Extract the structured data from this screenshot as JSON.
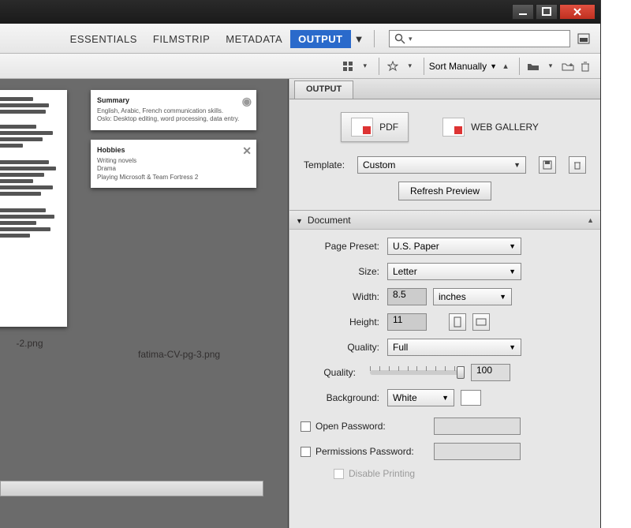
{
  "workspaces": {
    "essentials": "ESSENTIALS",
    "filmstrip": "FILMSTRIP",
    "metadata": "METADATA",
    "output": "OUTPUT"
  },
  "search": {
    "placeholder": ""
  },
  "sortbar": {
    "sort_label": "Sort Manually"
  },
  "thumbs": {
    "file1": "-2.png",
    "file2": "fatima-CV-pg-3.png"
  },
  "panel": {
    "tab": "OUTPUT",
    "mode_pdf": "PDF",
    "mode_web": "WEB GALLERY",
    "template_label": "Template:",
    "template_value": "Custom",
    "refresh": "Refresh Preview",
    "doc_header": "Document",
    "page_preset_label": "Page Preset:",
    "page_preset_value": "U.S. Paper",
    "size_label": "Size:",
    "size_value": "Letter",
    "width_label": "Width:",
    "width_value": "8.5",
    "width_units": "inches",
    "height_label": "Height:",
    "height_value": "11",
    "quality_label": "Quality:",
    "quality_value": "Full",
    "quality_slider_label": "Quality:",
    "quality_num": "100",
    "background_label": "Background:",
    "background_value": "White",
    "open_pw_label": "Open Password:",
    "perm_pw_label": "Permissions Password:",
    "disable_print": "Disable Printing"
  }
}
